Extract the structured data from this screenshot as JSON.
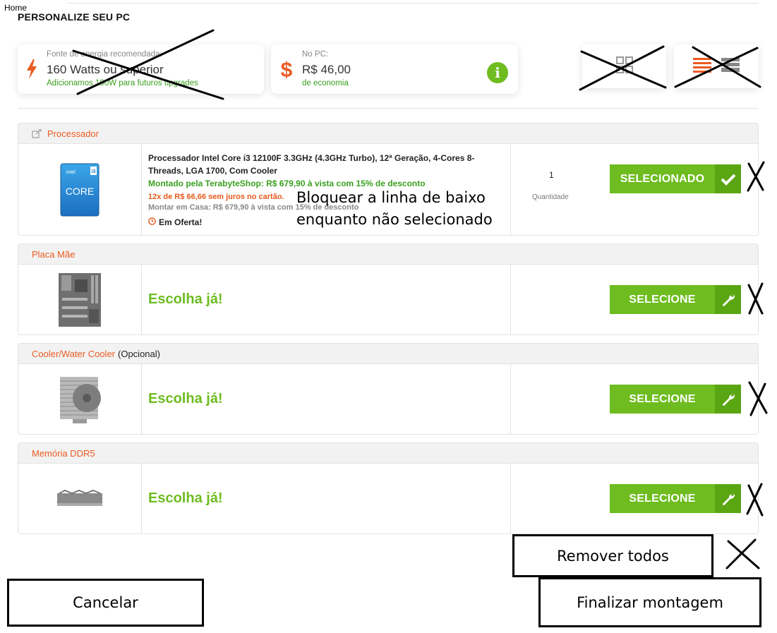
{
  "nav": {
    "home": "Home"
  },
  "header": {
    "title": "PERSONALIZE SEU PC"
  },
  "power_card": {
    "label": "Fonte de energia recomendada:",
    "value": "160 Watts ou superior",
    "sub": "Adicionamos 100W para futuros upgrades",
    "icon": "lightning-icon"
  },
  "pc_card": {
    "label": "No PC:",
    "value": "R$ 46,00",
    "sub": "de economia",
    "icon": "dollar-icon",
    "info_glyph": "i"
  },
  "sections": {
    "processor": {
      "title": "Processador",
      "product": {
        "name": "Processador Intel Core i3 12100F 3.3GHz (4.3GHz Turbo), 12ª Geração, 4-Cores 8-Threads, LGA 1700, Com Cooler",
        "price_store": "Montado pela TerabyteShop: R$ 679,90 à vista com 15% de desconto",
        "installments": "12x de R$ 66,66 sem juros no cartão.",
        "price_home": "Montar em Casa: R$ 679,90 à vista com 15% de desconto",
        "offer": "Em Oferta!"
      },
      "quantity": "1",
      "quantity_label": "Quantidade",
      "button": "SELECIONADO"
    },
    "motherboard": {
      "title": "Placa Mãe",
      "choose": "Escolha já!",
      "button": "SELECIONE"
    },
    "cooler": {
      "title": "Cooler/Water Cooler",
      "optional": "(Opcional)",
      "choose": "Escolha já!",
      "button": "SELECIONE"
    },
    "memory": {
      "title": "Memória DDR5",
      "choose": "Escolha já!",
      "button": "SELECIONE"
    }
  },
  "annotation": {
    "line1": "Bloquear a linha de baixo",
    "line2": "enquanto não selecionado"
  },
  "actions": {
    "remove_all": "Remover todos",
    "cancel": "Cancelar",
    "finish": "Finalizar montagem"
  },
  "colors": {
    "accent_orange": "#ea5b22",
    "accent_green": "#6ebc1f",
    "green_dark": "#5aa512"
  }
}
